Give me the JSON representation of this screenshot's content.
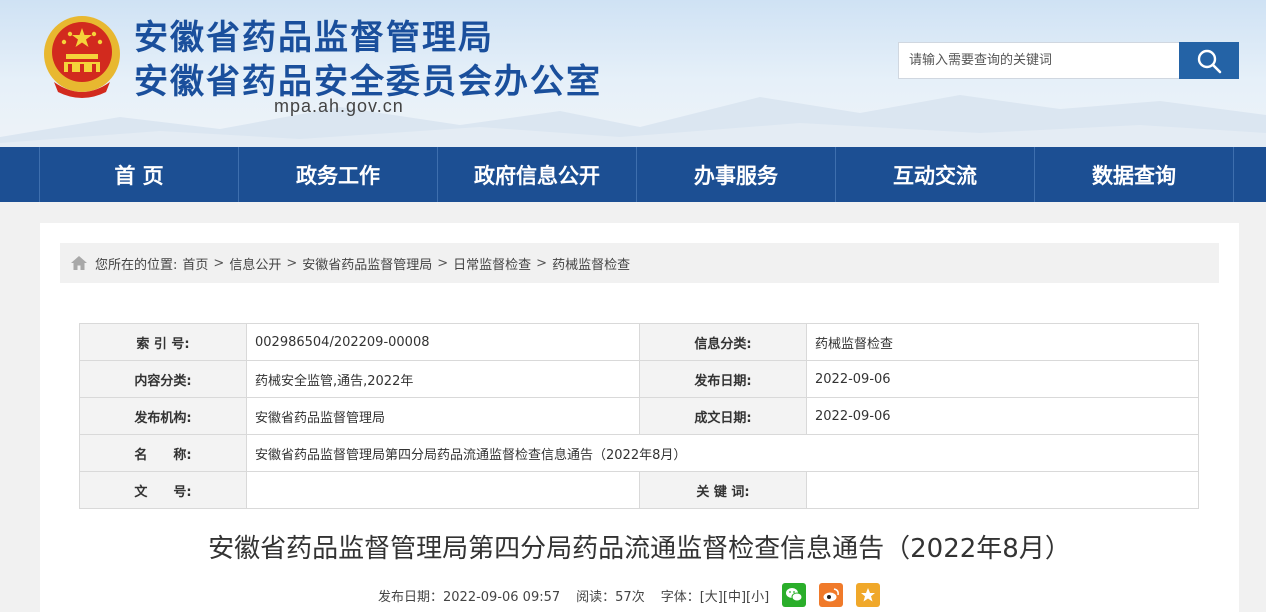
{
  "header": {
    "title_line1": "安徽省药品监督管理局",
    "title_line2": "安徽省药品安全委员会办公室",
    "domain": "mpa.ah.gov.cn",
    "search_placeholder": "请输入需要查询的关键词"
  },
  "nav": {
    "items": [
      {
        "label": "首 页"
      },
      {
        "label": "政务工作"
      },
      {
        "label": "政府信息公开"
      },
      {
        "label": "办事服务"
      },
      {
        "label": "互动交流"
      },
      {
        "label": "数据查询"
      }
    ]
  },
  "breadcrumb": {
    "prefix": "您所在的位置:",
    "items": [
      "首页",
      "信息公开",
      "安徽省药品监督管理局",
      "日常监督检查",
      "药械监督检查"
    ],
    "separator": ">"
  },
  "meta_table": {
    "index_label": "索 引 号:",
    "index_value": "002986504/202209-00008",
    "category_label": "信息分类:",
    "category_value": "药械监督检查",
    "content_cat_label": "内容分类:",
    "content_cat_value": "药械安全监管,通告,2022年",
    "pub_date_label": "发布日期:",
    "pub_date_value": "2022-09-06",
    "org_label": "发布机构:",
    "org_value": "安徽省药品监督管理局",
    "doc_date_label": "成文日期:",
    "doc_date_value": "2022-09-06",
    "name_label": "名　　称:",
    "name_value": "安徽省药品监督管理局第四分局药品流通监督检查信息通告（2022年8月）",
    "docno_label": "文　　号:",
    "docno_value": "",
    "keywords_label": "关 键 词:",
    "keywords_value": ""
  },
  "article": {
    "title": "安徽省药品监督管理局第四分局药品流通监督检查信息通告（2022年8月）",
    "publish_label": "发布日期：2022-09-06 09:57",
    "views_label": "阅读：57次",
    "font_label": "字体：",
    "font_large": "[大]",
    "font_medium": "[中]",
    "font_small": "[小]"
  },
  "colors": {
    "brand_blue": "#1a4f9c",
    "nav_blue": "#1c4f93",
    "wechat_green": "#2aae2a",
    "weibo_orange": "#f07a2a",
    "favorite_orange": "#f0a82a"
  },
  "icons": [
    "national-emblem-icon",
    "search-icon",
    "home-icon",
    "wechat-icon",
    "weibo-icon",
    "star-icon"
  ]
}
